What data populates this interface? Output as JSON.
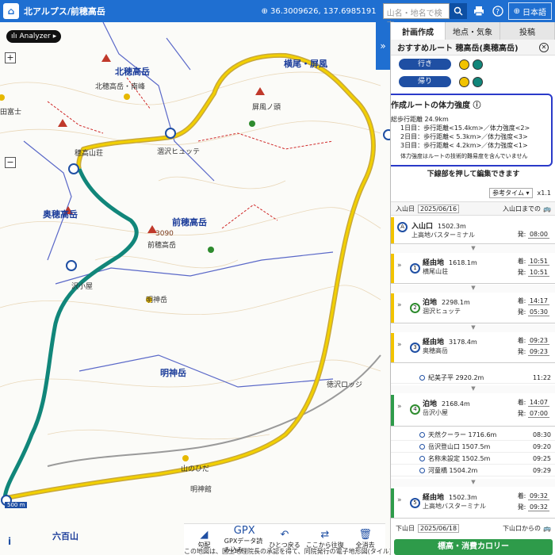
{
  "header": {
    "title": "北アルプス/前穂高岳",
    "coords": "36.3009626, 137.6985191",
    "search_placeholder": "山名・地名で検索",
    "language": "日本語"
  },
  "map": {
    "analyzer": "Analyzer",
    "places": {
      "kitahotaka": "北穂高岳",
      "okuhotaka": "奥穂高岳",
      "maehotaka": "前穂高岳",
      "myojin": "明神岳",
      "yokoo": "横尾・屏風",
      "roppyaku": "六百山"
    },
    "labels": {
      "kitahotaka_minami": "北穂高岳・南峰",
      "byobu_head": "屏風ノ頭",
      "karasawa_hutte": "涸沢ヒュッテ",
      "hotaka_sanso": "穂高山荘",
      "maehotaka_small": "前穂高岳",
      "elev_3090": "3090",
      "dake_hut": "沢小屋",
      "myojin_small": "明神岳",
      "tokusawa": "徳沢ロッジ",
      "yamanohida": "山のひだ",
      "myojinkan": "明神館",
      "gotai": "田富士"
    },
    "scale": "500 m",
    "copyright": "この地図は、国土地理院長の承認を得て、同院発行の電子地形図(タイル)を複製した"
  },
  "toolbar": {
    "slope": "勾配",
    "gpx_top": "GPX",
    "gpx": "GPXデータ読み込み",
    "undo": "ひとつ戻る",
    "from_here": "ここから往復",
    "clear": "全消去"
  },
  "panel": {
    "tabs": [
      "計画作成",
      "地点・気象",
      "投稿"
    ],
    "recommend_title": "おすすめルート 穂高岳(奥穂高岳)",
    "go_label": "行き",
    "return_label": "帰り",
    "go_color": "#f2c300",
    "return_color": "#11867a",
    "strength_title": "作成ルートの体力強度",
    "strength_total": "総歩行距離 24.9km",
    "strength_day1": "1日目：歩行距離<15.4km>／体力強度<2>",
    "strength_day2": "2日目：歩行距離< 5.3km>／体力強度<3>",
    "strength_day3": "3日目：歩行距離< 4.2km>／体力強度<1>",
    "strength_note": "体力強度はルートの技術的難易度を含んでいません",
    "edit_msg": "下線部を押して編集できます",
    "time_ref": "参考タイム",
    "multiplier": "x1.1",
    "start_label": "入山日",
    "start_date": "2025/06/16",
    "start_until": "入山口までの",
    "end_label": "下山日",
    "end_date": "2025/06/18",
    "end_from": "下山口からの",
    "cta": "標高・消費カロリー"
  },
  "stops": [
    {
      "type": "入山口",
      "alt": "1502.3m",
      "place": "上高地バスターミナル",
      "dep": "08:00",
      "color": "#f2c300"
    },
    {
      "type": "経由地",
      "alt": "1618.1m",
      "place": "横尾山荘",
      "arr": "10:51",
      "dep": "10:51",
      "color": "#1f4fa3"
    },
    {
      "type": "泊地",
      "alt": "2298.1m",
      "place": "涸沢ヒュッテ",
      "arr": "14:17",
      "dep": "05:30",
      "color": "#2e8b2e"
    },
    {
      "type": "経由地",
      "alt": "3178.4m",
      "place": "奥穂高岳",
      "arr": "09:23",
      "dep": "09:23",
      "color": "#1f4fa3"
    },
    {
      "type": "泊地",
      "alt": "2168.4m",
      "place": "岳沢小屋",
      "arr": "14:07",
      "dep": "07:00",
      "color": "#2e8b2e"
    },
    {
      "type": "経由地",
      "alt": "1502.3m",
      "place": "上高地バスターミナル",
      "arr": "09:32",
      "dep": "09:32",
      "color": "#1f4fa3"
    }
  ],
  "waypoints_a": [
    {
      "name": "紀美子平 2920.2m",
      "time": "11:22"
    }
  ],
  "waypoints_b": [
    {
      "name": "天然クーラー 1716.6m",
      "time": "08:30"
    },
    {
      "name": "岳沢登山口 1507.5m",
      "time": "09:20"
    },
    {
      "name": "名称未設定 1502.5m",
      "time": "09:25"
    },
    {
      "name": "河童橋 1504.2m",
      "time": "09:29"
    }
  ]
}
